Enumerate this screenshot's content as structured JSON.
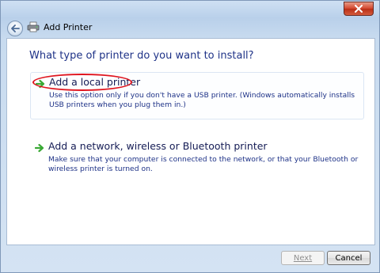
{
  "window": {
    "title": "Add Printer",
    "close_icon": "close-icon",
    "back_icon": "back-arrow-icon",
    "app_icon": "printer-icon"
  },
  "main": {
    "heading": "What type of printer do you want to install?",
    "options": [
      {
        "title": "Add a local printer",
        "description": "Use this option only if you don't have a USB printer. (Windows automatically installs USB printers when you plug them in.)",
        "icon": "green-arrow-icon",
        "highlighted": true
      },
      {
        "title": "Add a network, wireless or Bluetooth printer",
        "description": "Make sure that your computer is connected to the network, or that your Bluetooth or wireless printer is turned on.",
        "icon": "green-arrow-icon",
        "highlighted": false
      }
    ]
  },
  "footer": {
    "next_label": "Next",
    "next_enabled": false,
    "cancel_label": "Cancel"
  },
  "colors": {
    "heading": "#1e3287",
    "highlight_ring": "#e0141e",
    "arrow": "#3aa935"
  }
}
